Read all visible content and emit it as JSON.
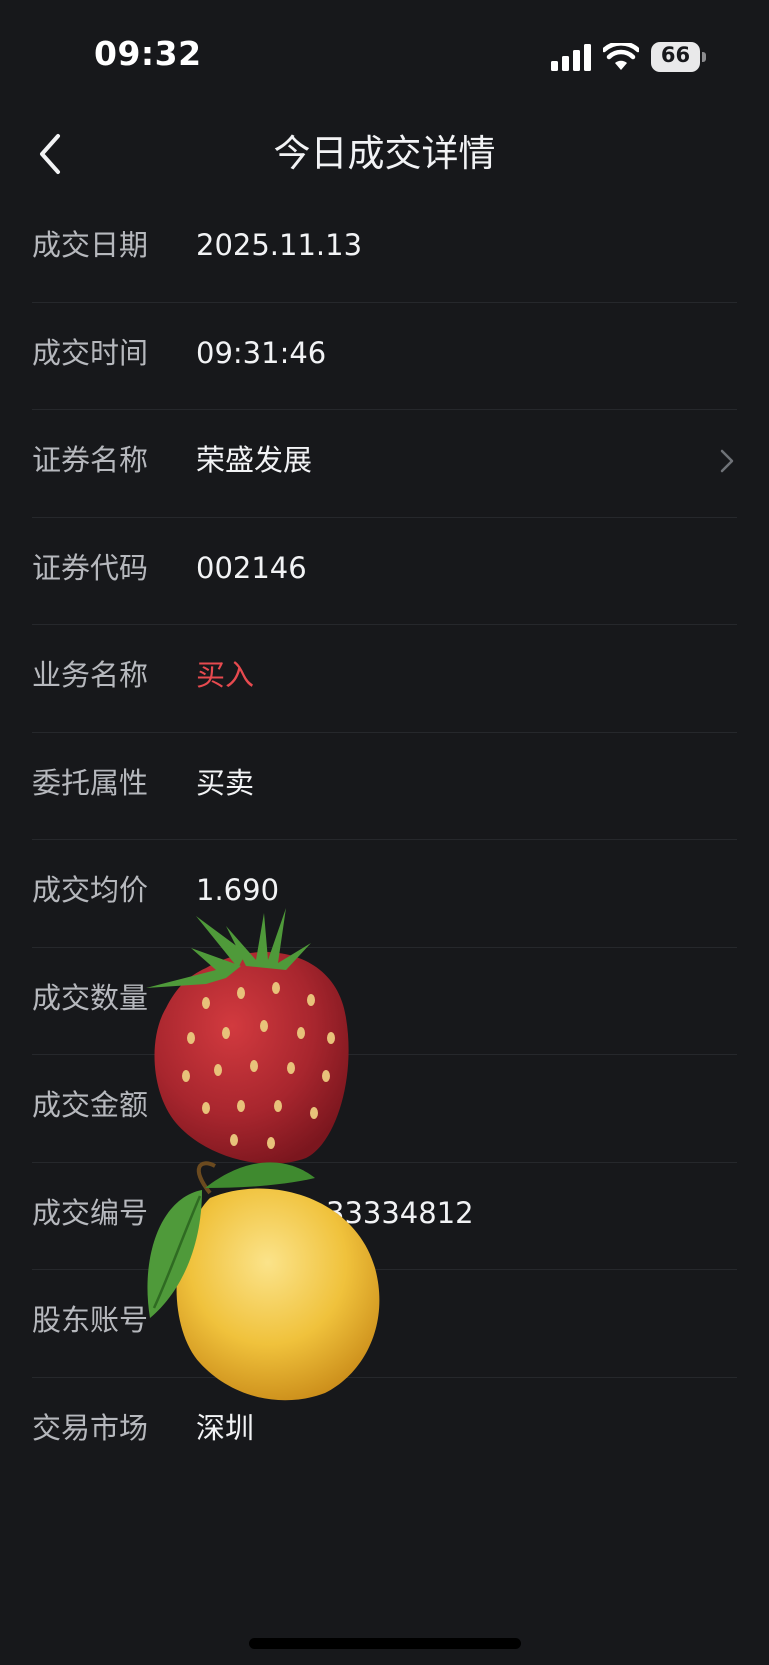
{
  "status_bar": {
    "time": "09:32",
    "battery_level": "66",
    "icons": [
      "signal-icon",
      "wifi-icon",
      "battery-icon"
    ]
  },
  "nav": {
    "title": "今日成交详情",
    "back_icon": "chevron-left-icon"
  },
  "details": {
    "rows": [
      {
        "label": "成交日期",
        "value": "2025.11.13"
      },
      {
        "label": "成交时间",
        "value": "09:31:46"
      },
      {
        "label": "证券名称",
        "value": "荣盛发展"
      },
      {
        "label": "证券代码",
        "value": "002146"
      },
      {
        "label": "业务名称",
        "value": "买入"
      },
      {
        "label": "委托属性",
        "value": "买卖"
      },
      {
        "label": "成交均价",
        "value": "1.690"
      },
      {
        "label": "成交数量",
        "value": ""
      },
      {
        "label": "成交金额",
        "value": ""
      },
      {
        "label": "成交编号",
        "value": "33334812"
      },
      {
        "label": "股东账号",
        "value": ""
      },
      {
        "label": "交易市场",
        "value": "深圳"
      }
    ]
  },
  "colors": {
    "background": "#17181b",
    "buy_red": "#e74a4f",
    "label_gray": "#b6b8bd"
  }
}
